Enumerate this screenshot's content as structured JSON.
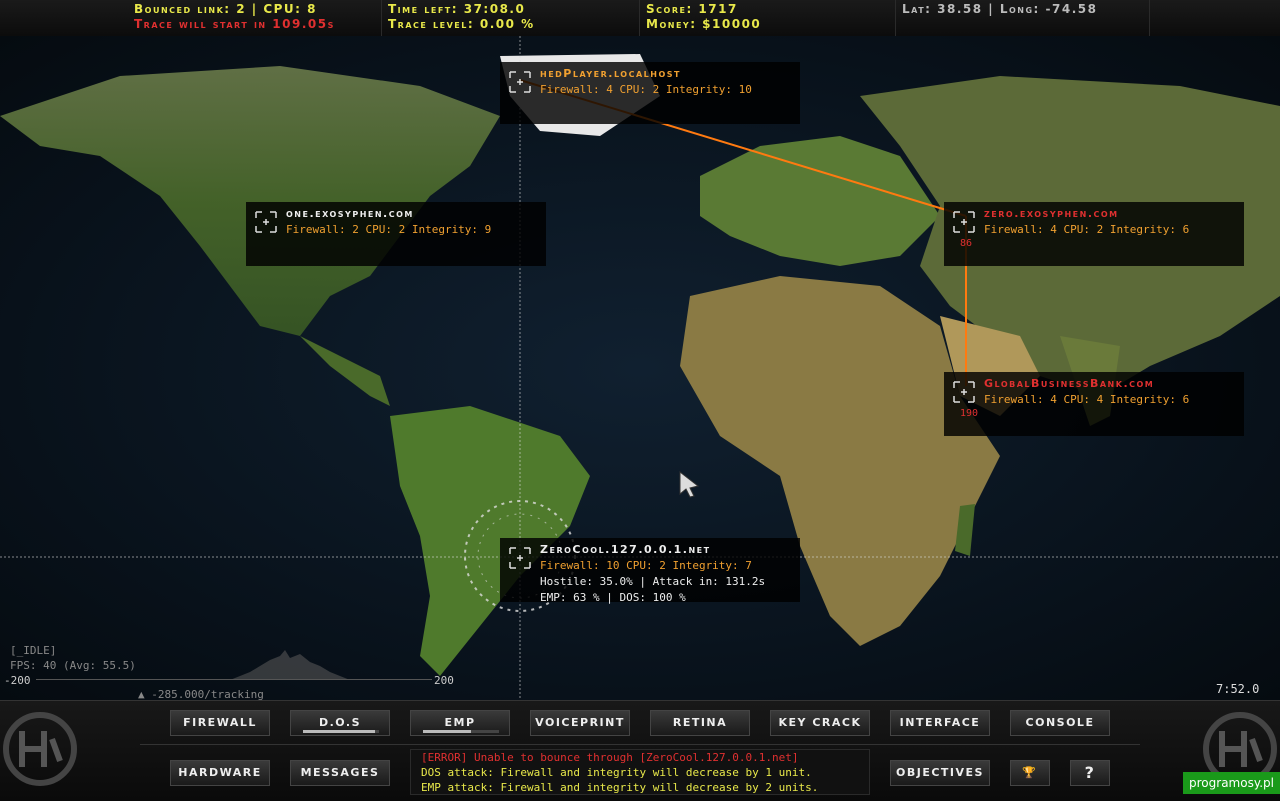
{
  "topbar": {
    "bounced": "Bounced link: 2 | CPU: 8",
    "trace_start": "Trace will start in 109.05s",
    "time_left": "Time left: 37:08.0",
    "trace_level": "Trace level: 0.00 %",
    "score": "Score: 1717",
    "money": "Money: $10000",
    "coords": "Lat: 38.58 | Long: -74.58"
  },
  "nodes": [
    {
      "name": "hedPlayer.localhost",
      "stats": "Firewall: 4 CPU: 2 Integrity: 10",
      "color": "#f0a030"
    },
    {
      "name": "one.exosyphen.com",
      "stats": "Firewall: 2 CPU: 2 Integrity: 9",
      "color": "#eee"
    },
    {
      "name": "zero.exosyphen.com",
      "stats": "Firewall: 4 CPU: 2 Integrity: 6",
      "color": "#e03030",
      "damage": "86"
    },
    {
      "name": "GlobalBusinessBank.com",
      "stats": "Firewall: 4 CPU: 4 Integrity: 6",
      "color": "#e03030",
      "damage": "190"
    },
    {
      "name": "ZeroCool.127.0.0.1.net",
      "stats": "Firewall: 10 CPU: 2 Integrity: 7",
      "extra1": "Hostile: 35.0% | Attack in: 131.2s",
      "extra2": "EMP:  63 % | DOS: 100 %",
      "color": "#eee"
    }
  ],
  "hud": {
    "idle": "[_IDLE]",
    "fps": "FPS:  40 (Avg: 55.5)",
    "min": "-200",
    "max": "200",
    "tracking": "-285.000/tracking",
    "clock": "7:52.0"
  },
  "buttons_row1": [
    "FIREWALL",
    "D.O.S",
    "EMP",
    "VOICEPRINT",
    "RETINA",
    "KEY CRACK",
    "INTERFACE",
    "CONSOLE"
  ],
  "buttons_row2": [
    "HARDWARE",
    "MESSAGES"
  ],
  "objectives_label": "OBJECTIVES",
  "trophy_icon": "🏆",
  "help_label": "?",
  "dos_progress": 0.95,
  "emp_progress": 0.63,
  "console": {
    "line1": "[ERROR] Unable to bounce through [ZeroCool.127.0.0.1.net]",
    "line2": "DOS attack: Firewall and integrity will decrease by 1 unit.",
    "line3": "EMP attack: Firewall and integrity will decrease by 2 units."
  },
  "watermark": "programosy.pl"
}
